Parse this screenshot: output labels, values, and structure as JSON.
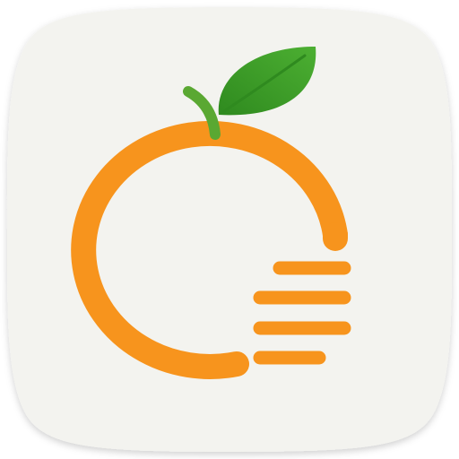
{
  "icon": {
    "symbol": "orange-fruit-list-icon",
    "colors": {
      "tile_background": "#f3f3ef",
      "tile_shadow": "#d9d9d3",
      "orange": "#f7941d",
      "orange_highlight": "#ffb24a",
      "leaf": "#4caf32",
      "leaf_dark": "#2f8a1f",
      "stem": "#5aa832"
    },
    "list_lines": 4
  }
}
